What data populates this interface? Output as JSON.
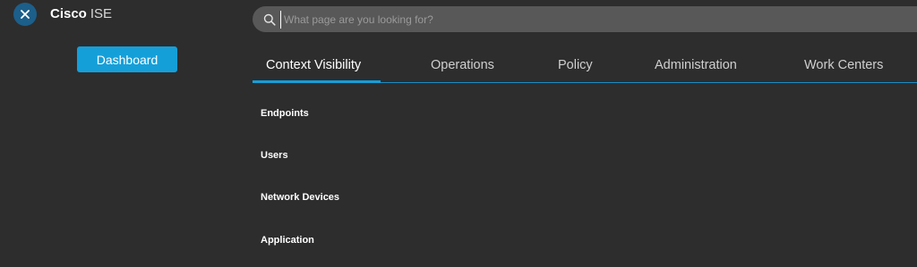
{
  "app": {
    "brand_bold": "Cisco",
    "brand_light": "ISE",
    "close_icon": "close-icon"
  },
  "sidebar": {
    "dashboard_label": "Dashboard"
  },
  "search": {
    "placeholder": "What page are you looking for?",
    "icon": "search-icon"
  },
  "tabs": [
    {
      "label": "Context Visibility",
      "active": true
    },
    {
      "label": "Operations",
      "active": false
    },
    {
      "label": "Policy",
      "active": false
    },
    {
      "label": "Administration",
      "active": false
    },
    {
      "label": "Work Centers",
      "active": false
    }
  ],
  "submenu": {
    "items": [
      {
        "label": "Endpoints"
      },
      {
        "label": "Users"
      },
      {
        "label": "Network Devices"
      },
      {
        "label": "Application"
      }
    ]
  },
  "colors": {
    "background": "#2d2d2e",
    "accent": "#159fd9",
    "search_bg": "#585858"
  }
}
